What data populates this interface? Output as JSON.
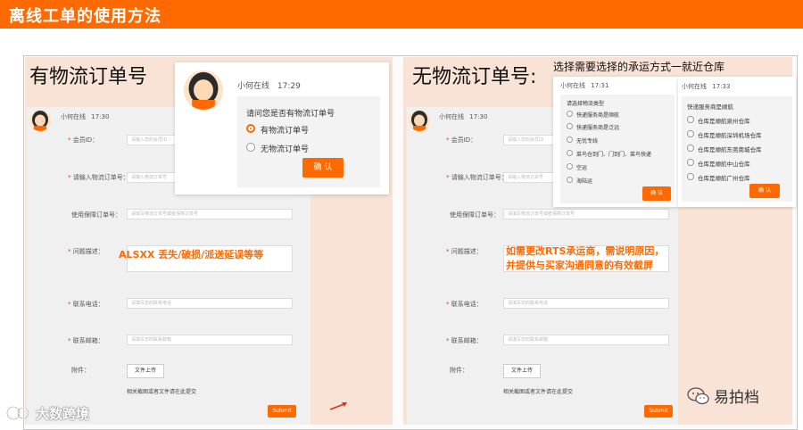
{
  "page": {
    "title": "离线工单的使用方法"
  },
  "left_panel": {
    "heading": "有物流订单号",
    "chat": {
      "name": "小何在线",
      "time": "17:30"
    },
    "form": {
      "fields": [
        {
          "label": "会员ID：",
          "placeholder": "请输入您的会员ID",
          "required": true
        },
        {
          "label": "请输入物流订单号：",
          "placeholder": "请输入物流订单号",
          "required": true
        },
        {
          "label": "使用保障订单号：",
          "placeholder": "请填写物流订单号或者保障订单号",
          "required": false
        },
        {
          "label": "问题描述：",
          "placeholder": "",
          "required": true
        },
        {
          "label": "联系电话：",
          "placeholder": "请填写您的联系电话",
          "required": true
        },
        {
          "label": "联系邮箱：",
          "placeholder": "请填写您的联系邮箱",
          "required": true
        }
      ],
      "attachment_label": "附件：",
      "upload_button": "文件上传",
      "note": "相关截图或者文件请在此提交",
      "submit": "Submit"
    },
    "annotation": "ALSXX 丢失/破损/派送延误等等",
    "popup": {
      "name": "小何在线",
      "time": "17:29",
      "question": "请问您是否有物流订单号",
      "options": [
        "有物流订单号",
        "无物流订单号"
      ],
      "selected_index": 0,
      "confirm": "确 认"
    }
  },
  "right_panel": {
    "heading": "无物流订单号:",
    "subheading": "选择需要选择的承运方式一就近仓库",
    "chat": {
      "name": "小何在线",
      "time": "17:30"
    },
    "form": {
      "fields": [
        {
          "label": "会员ID：",
          "placeholder": "请输入您的会员ID",
          "required": true
        },
        {
          "label": "请输入物流订单号：",
          "placeholder": "请输入物流订单号",
          "required": true
        },
        {
          "label": "使用保障订单号：",
          "placeholder": "请填写物流订单号或者保障订单号",
          "required": false
        },
        {
          "label": "问题描述：",
          "placeholder": "",
          "required": true
        },
        {
          "label": "联系电话：",
          "placeholder": "请填写您的联系电话",
          "required": true
        },
        {
          "label": "联系邮箱：",
          "placeholder": "请填写您的联系邮箱",
          "required": true
        }
      ],
      "attachment_label": "附件：",
      "upload_button": "文件上传",
      "note": "相关截图或者文件请在此提交",
      "submit": "Submit"
    },
    "annotation_line1": "如需更改RTS承运商，需说明原因，",
    "annotation_line2": "并提供与买家沟通同意的有效截屏",
    "popup1": {
      "name": "小何在线",
      "time": "17:31",
      "question": "请选择物流类型",
      "options": [
        "快递服务商是顺航",
        "快递服务商是泛远",
        "无忧专线",
        "菜鸟仓到门、门到门、菜鸟快递",
        "空运",
        "海陆运"
      ],
      "confirm": "确 认"
    },
    "popup2": {
      "name": "小何在线",
      "time": "17:33",
      "question": "快递服务商是顺航",
      "options": [
        "仓库是顺航泉州仓库",
        "仓库是顺航深圳机场仓库",
        "仓库是顺航东莞南城仓库",
        "仓库是顺航中山仓库",
        "仓库是顺航广州仓库"
      ],
      "confirm": "确 认"
    }
  },
  "watermarks": {
    "bottom_left": "大数跨境",
    "bottom_right": "易拍档"
  },
  "colors": {
    "accent": "#ff6a00",
    "panel_bg": "#f8e3d6"
  }
}
